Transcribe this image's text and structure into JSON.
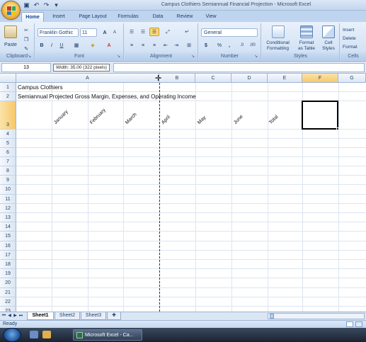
{
  "window": {
    "title": "Campus Clothiers Semiannual Financial Projection - Microsoft Excel"
  },
  "quick_access": [
    "save-icon",
    "undo-icon",
    "redo-icon",
    "customize-icon"
  ],
  "ribbon_tabs": [
    "Home",
    "Insert",
    "Page Layout",
    "Formulas",
    "Data",
    "Review",
    "View"
  ],
  "ribbon": {
    "clipboard": {
      "label": "Clipboard",
      "paste": "Paste"
    },
    "font": {
      "label": "Font",
      "name": "Franklin Gothic",
      "size": "11",
      "bold": "B",
      "italic": "I",
      "underline": "U",
      "grow": "A",
      "shrink": "A"
    },
    "alignment": {
      "label": "Alignment"
    },
    "number": {
      "label": "Number",
      "format": "General",
      "currency": "$",
      "percent": "%",
      "comma": ","
    },
    "styles": {
      "label": "Styles",
      "conditional": "Conditional",
      "conditional2": "Formatting",
      "format_table": "Format",
      "format_table2": "as Table",
      "cell_styles": "Cell",
      "cell_styles2": "Styles"
    },
    "cells": {
      "label": "Cells",
      "insert": "Insert",
      "delete": "Delete",
      "format": "Format"
    }
  },
  "formula_bar": {
    "name_box": "13",
    "tooltip": "Width: 35.00 (322 pixels)",
    "content": ""
  },
  "columns": [
    "A",
    "B",
    "C",
    "D",
    "E",
    "F",
    "G"
  ],
  "rows": [
    "1",
    "2",
    "3",
    "4",
    "5",
    "6",
    "7",
    "8",
    "9",
    "10",
    "11",
    "12",
    "13",
    "14",
    "15",
    "16",
    "17",
    "18",
    "19",
    "20",
    "21",
    "22",
    "23"
  ],
  "cells": {
    "A1": "Campus Clothiers",
    "A2": "Semiannual Projected Gross Margin, Expenses, and Operating Income",
    "row3_headers": [
      "January",
      "February",
      "March",
      "April",
      "May",
      "June",
      "Total"
    ]
  },
  "sheet_tabs": [
    "Sheet1",
    "Sheet2",
    "Sheet3"
  ],
  "status": {
    "text": "Ready"
  },
  "taskbar": {
    "excel_button": "Microsoft Excel - Ca..."
  }
}
